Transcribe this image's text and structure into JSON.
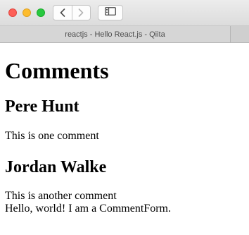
{
  "window": {
    "tab_title": "reactjs - Hello React.js - Qiita",
    "toolbar_icons": [
      "back-icon",
      "forward-icon",
      "sidebar-icon"
    ],
    "traffic_colors": {
      "close": "#fd5f57",
      "minimize": "#fdbc2e",
      "zoom": "#28c840"
    }
  },
  "page": {
    "heading": "Comments",
    "comments": [
      {
        "author": "Pere Hunt",
        "text": "This is one comment"
      },
      {
        "author": "Jordan Walke",
        "text": "This is another comment"
      }
    ],
    "comment_form": "Hello, world! I am a CommentForm."
  }
}
